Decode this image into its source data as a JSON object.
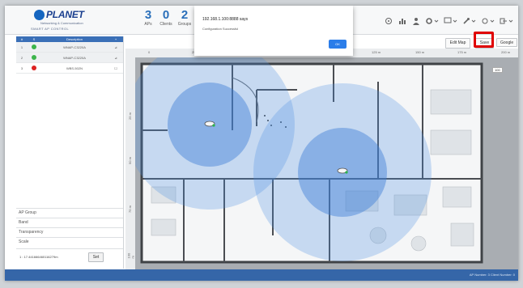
{
  "header": {
    "logo_text": "PLANET",
    "logo_sub": "Networking & Communication",
    "logo_sub2": "SMART AP CONTROL",
    "stats": [
      {
        "value": "3",
        "label": "APs"
      },
      {
        "value": "0",
        "label": "Clients"
      },
      {
        "value": "2",
        "label": "Groups"
      }
    ],
    "tools": [
      "refresh-icon",
      "chart-icon",
      "user-icon",
      "settings-icon",
      "monitor-icon",
      "tools-icon",
      "sync-icon",
      "logout-icon"
    ]
  },
  "dialog": {
    "title": "192.168.1.100:8888 says",
    "message": "Configuration Successful",
    "ok_label": "OK"
  },
  "ap_table": {
    "headers": [
      "#",
      "S",
      "Description",
      "+"
    ],
    "rows": [
      {
        "index": "1",
        "status": "online",
        "description": "WNAP-C3220A"
      },
      {
        "index": "2",
        "status": "online",
        "description": "WNAP-C3220A"
      },
      {
        "index": "3",
        "status": "offline",
        "description": "WBS-502N"
      }
    ]
  },
  "properties": {
    "ap_group": "AP Group",
    "band": "Band",
    "transparency": "Transparency",
    "scale": "Scale",
    "scale_value": "1 : 17.441666460116279m",
    "set_label": "Set"
  },
  "map_toolbar": {
    "edit_map_label": "Edit Map",
    "save_label": "Save",
    "provider_label": "Google"
  },
  "ruler": {
    "top": [
      "0",
      "25 m",
      "50 m",
      "75 m",
      "100 m",
      "125 m",
      "150 m",
      "175 m",
      "200 m"
    ],
    "left": [
      "25 m",
      "50 m",
      "75 m",
      "100 m"
    ],
    "zoom_label": "100"
  },
  "footer": {
    "text": "AP Number: 3   Client Number: 0"
  },
  "colors": {
    "accent": "#2a6fba",
    "coverage": "#4a90e2",
    "highlight": "#e00000",
    "footer": "#3566a8"
  }
}
